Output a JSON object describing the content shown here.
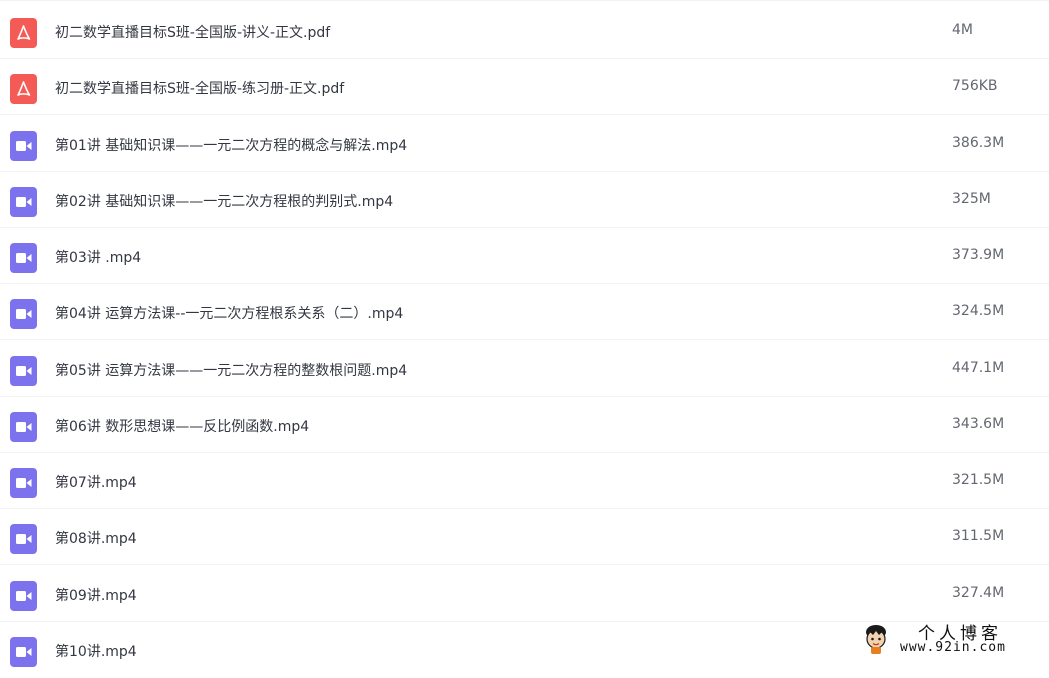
{
  "files": [
    {
      "type": "pdf",
      "icon": "pdf-icon",
      "name": "初二数学直播目标S班-全国版-讲义-正文.pdf",
      "size": "4M"
    },
    {
      "type": "pdf",
      "icon": "pdf-icon",
      "name": "初二数学直播目标S班-全国版-练习册-正文.pdf",
      "size": "756KB"
    },
    {
      "type": "video",
      "icon": "video-icon",
      "name": "第01讲 基础知识课——一元二次方程的概念与解法.mp4",
      "size": "386.3M"
    },
    {
      "type": "video",
      "icon": "video-icon",
      "name": "第02讲 基础知识课——一元二次方程根的判别式.mp4",
      "size": "325M"
    },
    {
      "type": "video",
      "icon": "video-icon",
      "name": "第03讲 .mp4",
      "size": "373.9M"
    },
    {
      "type": "video",
      "icon": "video-icon",
      "name": "第04讲 运算方法课--一元二次方程根系关系（二）.mp4",
      "size": "324.5M"
    },
    {
      "type": "video",
      "icon": "video-icon",
      "name": "第05讲 运算方法课——一元二次方程的整数根问题.mp4",
      "size": "447.1M"
    },
    {
      "type": "video",
      "icon": "video-icon",
      "name": "第06讲 数形思想课——反比例函数.mp4",
      "size": "343.6M"
    },
    {
      "type": "video",
      "icon": "video-icon",
      "name": "第07讲.mp4",
      "size": "321.5M"
    },
    {
      "type": "video",
      "icon": "video-icon",
      "name": "第08讲.mp4",
      "size": "311.5M"
    },
    {
      "type": "video",
      "icon": "video-icon",
      "name": "第09讲.mp4",
      "size": "327.4M"
    },
    {
      "type": "video",
      "icon": "video-icon",
      "name": "第10讲.mp4",
      "size": ""
    }
  ],
  "colors": {
    "pdf_icon": "#f45b56",
    "video_icon": "#7d72ee",
    "name_text": "#333741",
    "size_text": "#636770",
    "divider": "#f1f2f4"
  },
  "watermark": {
    "title": "个人博客",
    "url": "www.92in.com"
  }
}
